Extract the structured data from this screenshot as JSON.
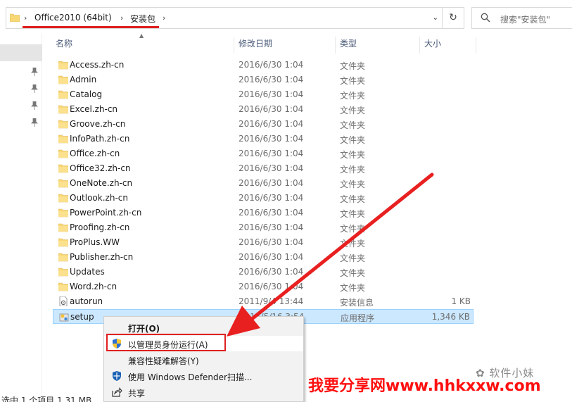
{
  "address": {
    "crumbs": [
      "Office2010 (64bit)",
      "安装包"
    ],
    "separator": "›",
    "dropdown": "⌄",
    "refresh": "↻"
  },
  "search": {
    "placeholder": "搜索\"安装包\""
  },
  "columns": {
    "name": "名称",
    "date": "修改日期",
    "type": "类型",
    "size": "大小"
  },
  "files": [
    {
      "name": "Access.zh-cn",
      "date": "2016/6/30 1:04",
      "type": "文件夹",
      "size": "",
      "icon": "folder-icon"
    },
    {
      "name": "Admin",
      "date": "2016/6/30 1:04",
      "type": "文件夹",
      "size": "",
      "icon": "folder-icon"
    },
    {
      "name": "Catalog",
      "date": "2016/6/30 1:04",
      "type": "文件夹",
      "size": "",
      "icon": "folder-icon"
    },
    {
      "name": "Excel.zh-cn",
      "date": "2016/6/30 1:04",
      "type": "文件夹",
      "size": "",
      "icon": "folder-icon"
    },
    {
      "name": "Groove.zh-cn",
      "date": "2016/6/30 1:04",
      "type": "文件夹",
      "size": "",
      "icon": "folder-icon"
    },
    {
      "name": "InfoPath.zh-cn",
      "date": "2016/6/30 1:04",
      "type": "文件夹",
      "size": "",
      "icon": "folder-icon"
    },
    {
      "name": "Office.zh-cn",
      "date": "2016/6/30 1:04",
      "type": "文件夹",
      "size": "",
      "icon": "folder-icon"
    },
    {
      "name": "Office32.zh-cn",
      "date": "2016/6/30 1:04",
      "type": "文件夹",
      "size": "",
      "icon": "folder-icon"
    },
    {
      "name": "OneNote.zh-cn",
      "date": "2016/6/30 1:04",
      "type": "文件夹",
      "size": "",
      "icon": "folder-icon"
    },
    {
      "name": "Outlook.zh-cn",
      "date": "2016/6/30 1:04",
      "type": "文件夹",
      "size": "",
      "icon": "folder-icon"
    },
    {
      "name": "PowerPoint.zh-cn",
      "date": "2016/6/30 1:04",
      "type": "文件夹",
      "size": "",
      "icon": "folder-icon"
    },
    {
      "name": "Proofing.zh-cn",
      "date": "2016/6/30 1:04",
      "type": "文件夹",
      "size": "",
      "icon": "folder-icon"
    },
    {
      "name": "ProPlus.WW",
      "date": "2016/6/30 1:04",
      "type": "文件夹",
      "size": "",
      "icon": "folder-icon"
    },
    {
      "name": "Publisher.zh-cn",
      "date": "2016/6/30 1:04",
      "type": "文件夹",
      "size": "",
      "icon": "folder-icon"
    },
    {
      "name": "Updates",
      "date": "2016/6/30 1:04",
      "type": "文件夹",
      "size": "",
      "icon": "folder-icon"
    },
    {
      "name": "Word.zh-cn",
      "date": "2016/6/30 1:04",
      "type": "文件夹",
      "size": "",
      "icon": "folder-icon"
    },
    {
      "name": "autorun",
      "date": "2011/9/4 13:44",
      "type": "安装信息",
      "size": "1 KB",
      "icon": "settings-file-icon"
    },
    {
      "name": "setup",
      "date": "2015/5/16 3:54",
      "type": "应用程序",
      "size": "1,346 KB",
      "icon": "setup-app-icon",
      "selected": true
    }
  ],
  "context_menu": {
    "open": "打开(O)",
    "run_as_admin": "以管理员身份运行(A)",
    "compat": "兼容性疑难解答(Y)",
    "defender": "使用 Windows Defender扫描...",
    "share": "共享"
  },
  "status": {
    "selected_text": "选中 1 个项目  1.31 MB"
  },
  "watermarks": {
    "wechat": "软件小妹",
    "site": "我要分享网www.hhkxxw.com"
  },
  "colors": {
    "accent_red": "#e02020",
    "selection": "#cce8ff",
    "folder": "#f8d775"
  }
}
